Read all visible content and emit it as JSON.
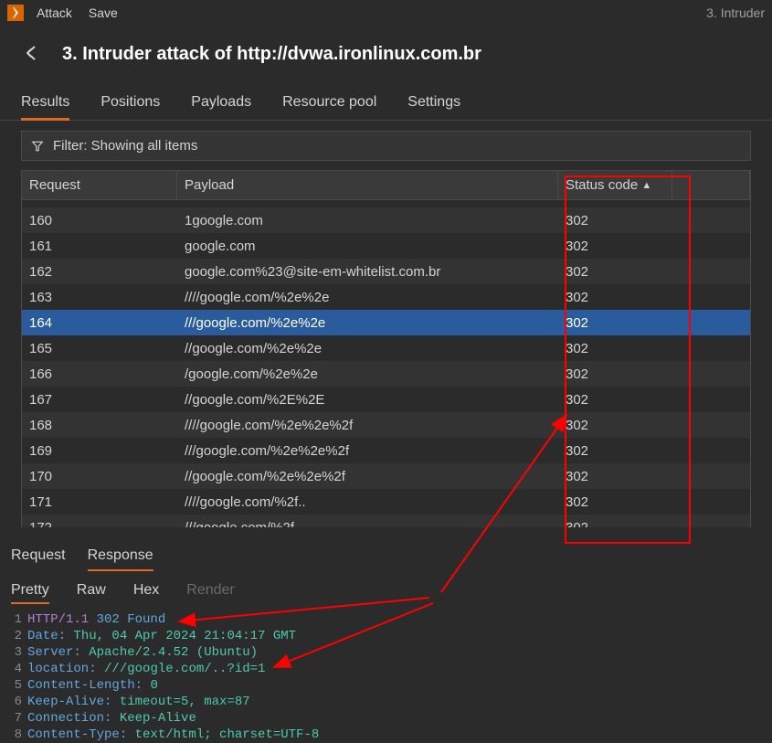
{
  "menubar": {
    "items": [
      "Attack",
      "Save"
    ],
    "window_label": "3. Intruder"
  },
  "header": {
    "title": "3. Intruder attack of http://dvwa.ironlinux.com.br"
  },
  "tabs": [
    "Results",
    "Positions",
    "Payloads",
    "Resource pool",
    "Settings"
  ],
  "filter_text": "Filter: Showing all items",
  "columns": {
    "request": "Request",
    "payload": "Payload",
    "status": "Status code"
  },
  "rows": [
    {
      "req": "",
      "pay": "",
      "status": ""
    },
    {
      "req": "160",
      "pay": "1google.com",
      "status": "302"
    },
    {
      "req": "161",
      "pay": "google.com",
      "status": "302"
    },
    {
      "req": "162",
      "pay": "google.com%23@site-em-whitelist.com.br",
      "status": "302"
    },
    {
      "req": "163",
      "pay": "////google.com/%2e%2e",
      "status": "302"
    },
    {
      "req": "164",
      "pay": "///google.com/%2e%2e",
      "status": "302"
    },
    {
      "req": "165",
      "pay": "//google.com/%2e%2e",
      "status": "302"
    },
    {
      "req": "166",
      "pay": "/google.com/%2e%2e",
      "status": "302"
    },
    {
      "req": "167",
      "pay": "//google.com/%2E%2E",
      "status": "302"
    },
    {
      "req": "168",
      "pay": "////google.com/%2e%2e%2f",
      "status": "302"
    },
    {
      "req": "169",
      "pay": "///google.com/%2e%2e%2f",
      "status": "302"
    },
    {
      "req": "170",
      "pay": "//google.com/%2e%2e%2f",
      "status": "302"
    },
    {
      "req": "171",
      "pay": "////google.com/%2f..",
      "status": "302"
    },
    {
      "req": "172",
      "pay": "///google.com/%2f..",
      "status": "302"
    }
  ],
  "selected_index": 5,
  "detail_tabs": [
    "Request",
    "Response"
  ],
  "view_tabs": [
    "Pretty",
    "Raw",
    "Hex",
    "Render"
  ],
  "response_lines": [
    {
      "n": "1",
      "type": "status",
      "method": "HTTP/1.1",
      "code": "302",
      "reason": "Found"
    },
    {
      "n": "2",
      "type": "header",
      "key": "Date:",
      "val": "Thu, 04 Apr 2024 21:04:17 GMT"
    },
    {
      "n": "3",
      "type": "header",
      "key": "Server:",
      "val": "Apache/2.4.52 (Ubuntu)"
    },
    {
      "n": "4",
      "type": "header",
      "key": "location:",
      "val": "///google.com/..?id=1"
    },
    {
      "n": "5",
      "type": "header",
      "key": "Content-Length:",
      "val": "0"
    },
    {
      "n": "6",
      "type": "header",
      "key": "Keep-Alive:",
      "val": "timeout=5, max=87"
    },
    {
      "n": "7",
      "type": "header",
      "key": "Connection:",
      "val": "Keep-Alive"
    },
    {
      "n": "8",
      "type": "header",
      "key": "Content-Type:",
      "val": "text/html; charset=UTF-8"
    }
  ]
}
